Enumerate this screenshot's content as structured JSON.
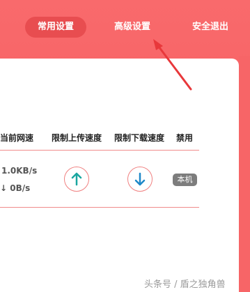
{
  "nav": {
    "common_settings": "常用设置",
    "advanced_settings": "高级设置",
    "safe_logout": "安全退出"
  },
  "table": {
    "headers": {
      "current_speed": "当前网速",
      "limit_upload": "限制上传速度",
      "limit_download": "限制下载速度",
      "disable": "禁用"
    },
    "row": {
      "upload_speed": "1.0KB/s",
      "download_speed": "0B/s",
      "device_badge": "本机"
    }
  },
  "icons": {
    "upload": "arrow-up-icon",
    "download": "arrow-down-icon",
    "speed_down": "down-arrow-icon",
    "annotation": "annotation-arrow"
  },
  "watermark": "头条号 / 盾之独角兽",
  "colors": {
    "brand": "#f76567",
    "active_tab": "#e84d50",
    "up_arrow": "#1aa6a0",
    "down_arrow": "#1e88c8",
    "badge": "#7d7d7d"
  }
}
